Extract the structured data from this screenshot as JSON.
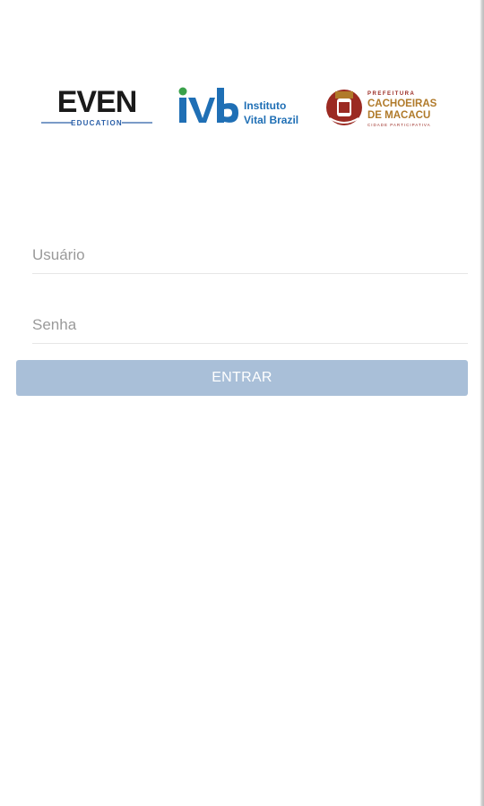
{
  "logos": {
    "even": {
      "wordmark": "EVEN",
      "subtitle": "EDUCATION"
    },
    "ivb": {
      "mark": "ivb",
      "line1": "Instituto",
      "line2": "Vital Brazil"
    },
    "prefeitura": {
      "line1": "PREFEITURA",
      "line2": "CACHOEIRAS",
      "line3": "DE MACACU",
      "line4": "CIDADE PARTICIPATIVA"
    }
  },
  "form": {
    "username_placeholder": "Usuário",
    "username_value": "",
    "password_placeholder": "Senha",
    "password_value": "",
    "submit_label": "ENTRAR"
  },
  "colors": {
    "button_bg": "#a9bfd8",
    "button_text": "#ffffff",
    "placeholder": "#9a9a9a",
    "even_black": "#1a1a1a",
    "even_blue": "#2a5fa8",
    "ivb_blue": "#1f6fb5",
    "ivb_green": "#3aa14a",
    "prefeitura_brown": "#b07a2a",
    "prefeitura_red": "#9b2a22"
  }
}
